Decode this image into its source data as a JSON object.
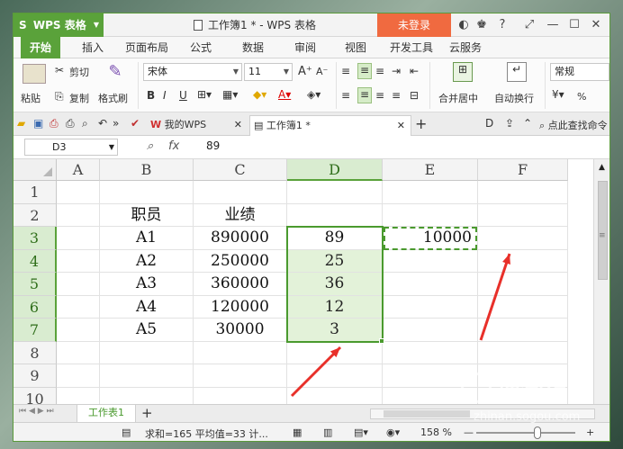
{
  "window": {
    "app_name": "WPS 表格",
    "app_logo": "S",
    "title": "工作簿1 * - WPS 表格",
    "login_label": "未登录",
    "controls": [
      "◐",
      "♚",
      "?",
      "⤢",
      "—",
      "☐",
      "✕"
    ]
  },
  "menu": {
    "tabs": [
      "开始",
      "插入",
      "页面布局",
      "公式",
      "数据",
      "审阅",
      "视图",
      "开发工具",
      "云服务"
    ]
  },
  "ribbon": {
    "paste": "粘贴",
    "cut": "剪切",
    "copy": "复制",
    "format_painter": "格式刷",
    "font_name": "宋体",
    "font_size": "11",
    "merge_center": "合并居中",
    "wrap_text": "自动换行",
    "number_format": "常规",
    "percent": "%"
  },
  "doc_tabs": {
    "my_wps": "我的WPS",
    "workbook": "工作簿1 *",
    "add": "+",
    "search_label": "点此查找命令"
  },
  "formula_bar": {
    "name_box": "D3",
    "fx": "fx",
    "value": "89"
  },
  "grid": {
    "columns": [
      "A",
      "B",
      "C",
      "D",
      "E",
      "F"
    ],
    "rows": [
      "1",
      "2",
      "3",
      "4",
      "5",
      "6",
      "7",
      "8",
      "9",
      "10"
    ],
    "cells": {
      "B2": "职员",
      "C2": "业绩",
      "B3": "A1",
      "C3": "890000",
      "D3": "89",
      "E3": "10000",
      "B4": "A2",
      "C4": "250000",
      "D4": "25",
      "B5": "A3",
      "C5": "360000",
      "D5": "36",
      "B6": "A4",
      "C6": "120000",
      "D6": "12",
      "B7": "A5",
      "C7": "30000",
      "D7": "3"
    }
  },
  "sheets": {
    "active": "工作表1",
    "add": "+"
  },
  "status": {
    "summary": "求和=165  平均值=33  计...",
    "zoom": "158 %",
    "zoom_minus": "—",
    "zoom_plus": "+"
  },
  "watermark": {
    "brand": "搜狗指南",
    "url": "zhinan.sogou.com"
  },
  "colors": {
    "accent": "#5aa23a",
    "login": "#f06a40",
    "arrow": "#e8302a",
    "selection_fill": "#e3f2d9"
  }
}
